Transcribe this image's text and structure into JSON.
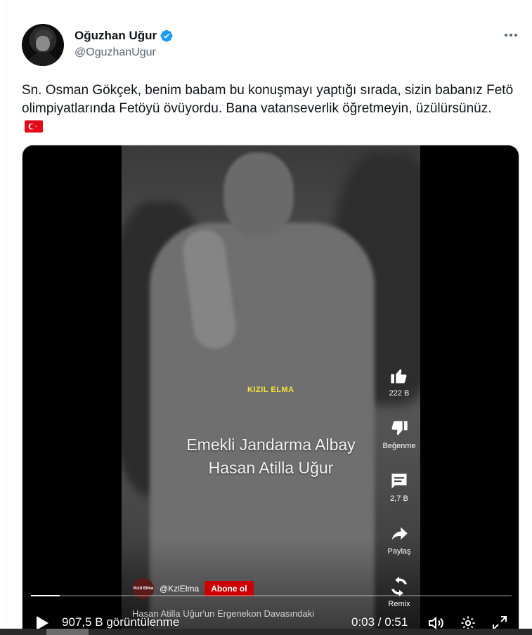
{
  "author": {
    "display_name": "Oğuzhan Uğur",
    "handle": "@OguzhanUgur",
    "verified_icon": "verified-badge-icon",
    "avatar_icon": "avatar"
  },
  "menu": {
    "icon": "more-icon"
  },
  "tweet": {
    "text": "Sn. Osman Gökçek, benim babam bu konuşmayı yaptığı sırada, sizin babanız Fetö olimpiyatlarında Fetöyü övüyordu. Bana vatanseverlik öğretmeyin, üzülürsünüz.",
    "flag_icon": "turkey-flag-icon"
  },
  "video": {
    "channel_tag": "KIZIL ELMA",
    "overlay_line1": "Emekli Jandarma Albay",
    "overlay_line2": "Hasan Atilla Uğur",
    "actions": [
      {
        "icon": "like-icon",
        "label": "222 B"
      },
      {
        "icon": "dislike-icon",
        "label": "Beğenme"
      },
      {
        "icon": "comment-icon",
        "label": "2,7 B"
      },
      {
        "icon": "share-icon",
        "label": "Paylaş"
      },
      {
        "icon": "remix-icon",
        "label": "Remix"
      }
    ],
    "channel_logo_text": "Kızıl Elma",
    "channel_handle": "@KzlElma",
    "subscribe_label": "Abone ol",
    "caption": "Hasan Atilla Uğur'un Ergenekon Davasındaki",
    "views_label": "907,5 B görüntülenme",
    "time_current": "0:03",
    "time_total": "0:51",
    "time_display": "0:03 / 0:51",
    "progress_fraction": 0.06,
    "colors": {
      "subscribe": "#cc0000",
      "tag": "#f7e13a",
      "verified": "#1d9bf0"
    }
  }
}
